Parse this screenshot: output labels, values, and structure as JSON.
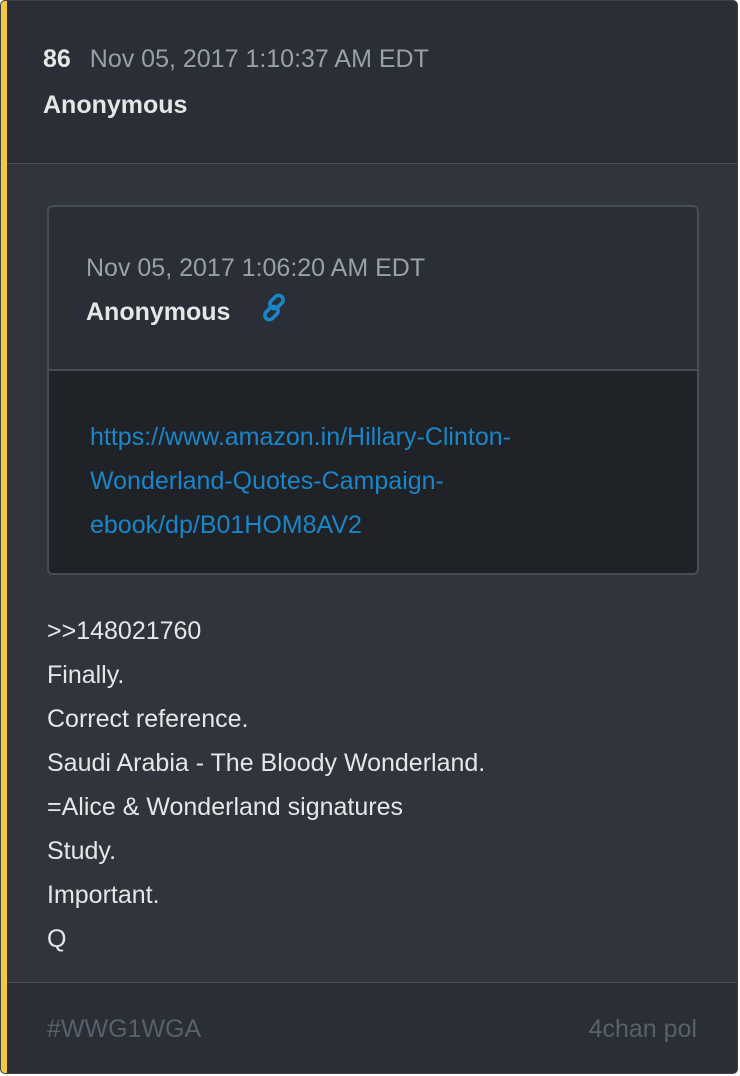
{
  "post": {
    "number": "86",
    "timestamp": "Nov 05, 2017 1:10:37 AM EDT",
    "author": "Anonymous"
  },
  "quoted_post": {
    "timestamp": "Nov 05, 2017 1:06:20 AM EDT",
    "author": "Anonymous",
    "link_icon": "link-icon",
    "link_text": "https://www.amazon.in/Hillary-Clinton-Wonderland-Quotes-Campaign-ebook/dp/B01HOM8AV2"
  },
  "body": {
    "lines": [
      ">>148021760",
      "Finally.",
      "Correct reference.",
      "Saudi Arabia - The Bloody Wonderland.",
      "=Alice & Wonderland signatures",
      "Study.",
      "Important.",
      "Q"
    ]
  },
  "footer": {
    "tag": "#WWG1WGA",
    "source": "4chan pol"
  },
  "colors": {
    "accent": "#f5c842",
    "link": "#1a86c8",
    "background": "#2f343d"
  }
}
